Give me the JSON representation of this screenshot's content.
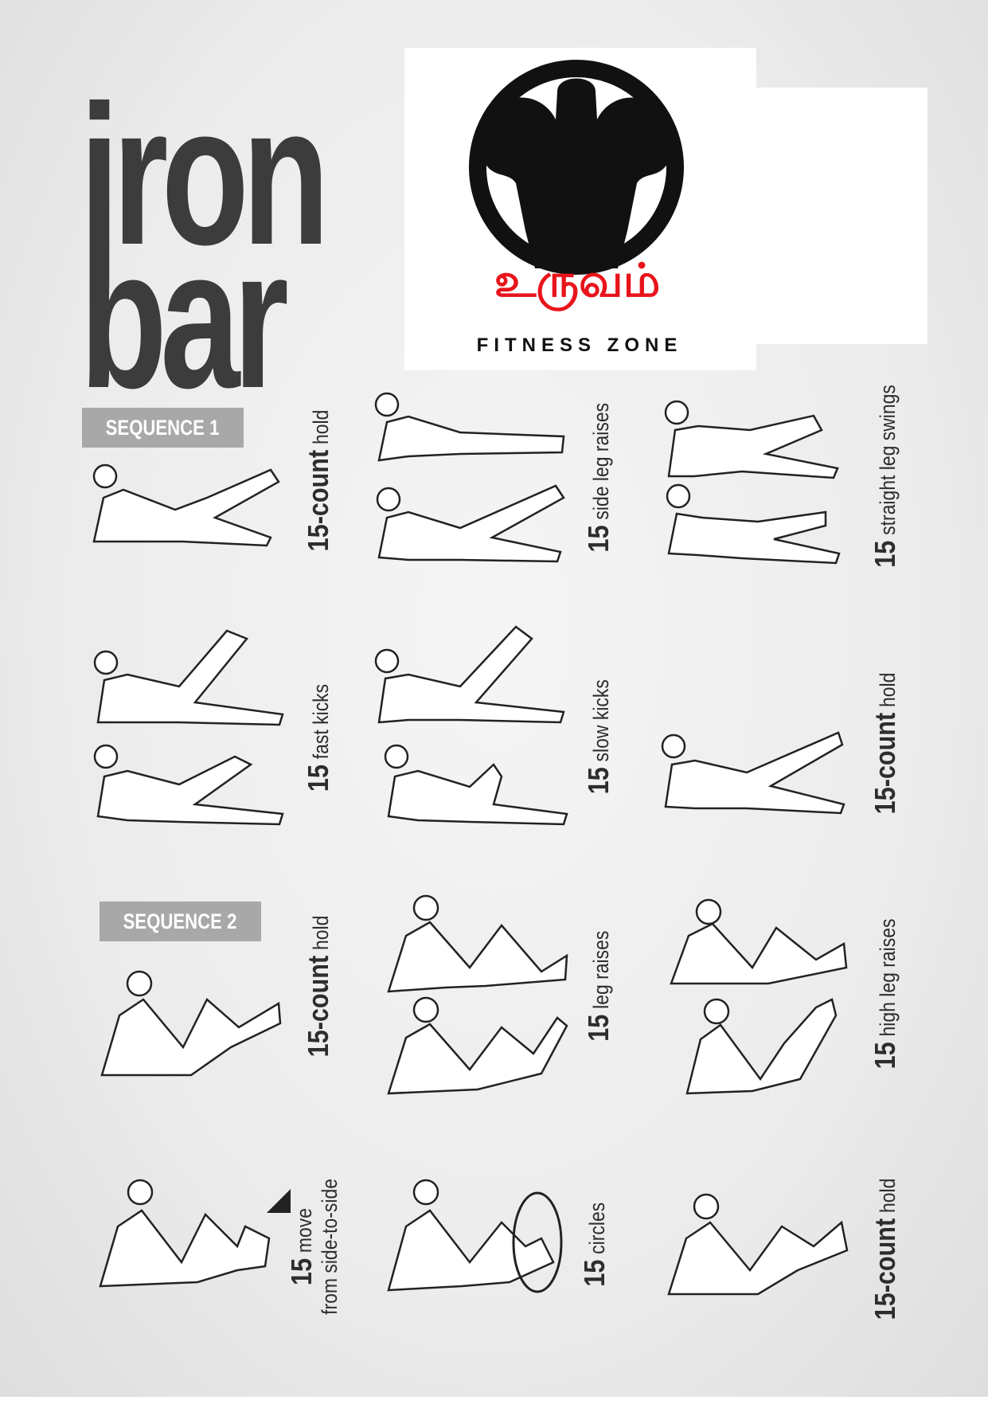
{
  "title": {
    "line1": "iron",
    "line2": "bar"
  },
  "logo": {
    "tamil_text": "உருவம்",
    "subtitle": "FITNESS ZONE",
    "icon": "bodybuilder-emblem-icon",
    "colors": {
      "red": "#e8141b",
      "black": "#111111"
    }
  },
  "sequences": [
    {
      "label": "SEQUENCE 1"
    },
    {
      "label": "SEQUENCE 2"
    }
  ],
  "exercises": [
    {
      "num": "15-count",
      "text": "hold"
    },
    {
      "num": "15",
      "text": "side leg raises"
    },
    {
      "num": "15",
      "text": "straight leg swings"
    },
    {
      "num": "15",
      "text": "fast kicks"
    },
    {
      "num": "15",
      "text": "slow kicks"
    },
    {
      "num": "15-count",
      "text": "hold"
    },
    {
      "num": "15-count",
      "text": "hold"
    },
    {
      "num": "15",
      "text": "leg raises"
    },
    {
      "num": "15",
      "text": "high leg raises"
    },
    {
      "num": "15",
      "text": "move",
      "text2": "from side-to-side"
    },
    {
      "num": "15",
      "text": "circles"
    },
    {
      "num": "15-count",
      "text": "hold"
    }
  ],
  "colors": {
    "title": "#3c3c3c",
    "badge": "#a8a8a8",
    "ink": "#2d2d2d"
  }
}
